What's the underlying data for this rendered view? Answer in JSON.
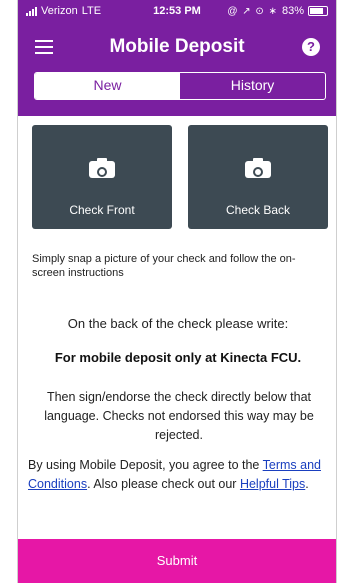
{
  "status_bar": {
    "carrier": "Verizon",
    "network": "LTE",
    "time": "12:53 PM",
    "glyphs": "@ ↗ ⊙ ∗",
    "battery": "83%",
    "battery_level": 0.83
  },
  "header": {
    "title": "Mobile Deposit",
    "menu_icon": "hamburger-menu-icon",
    "help_icon": "help-question-icon",
    "help_glyph": "?"
  },
  "tabs": [
    {
      "label": "New",
      "active": true
    },
    {
      "label": "History",
      "active": false
    }
  ],
  "capture": {
    "front_label": "Check Front",
    "back_label": "Check Back",
    "icon": "camera-icon"
  },
  "instructions": "Simply snap a picture of your check and follow the on-screen instructions",
  "back_of_check": "On the back of the check please write:",
  "deposit_statement": "For mobile deposit only at Kinecta FCU.",
  "endorse_text": "Then sign/endorse the check directly below that language. Checks not endorsed this way may be rejected.",
  "agreement": {
    "prefix": "By using Mobile Deposit, you agree to the ",
    "terms_link": "Terms and Conditions",
    "middle": ". Also please check out our ",
    "tips_link": "Helpful Tips",
    "suffix": "."
  },
  "submit_label": "Submit",
  "colors": {
    "header": "#7a1fa0",
    "capture_button": "#3d4a53",
    "submit": "#e617a6",
    "link": "#1a3fbf"
  }
}
